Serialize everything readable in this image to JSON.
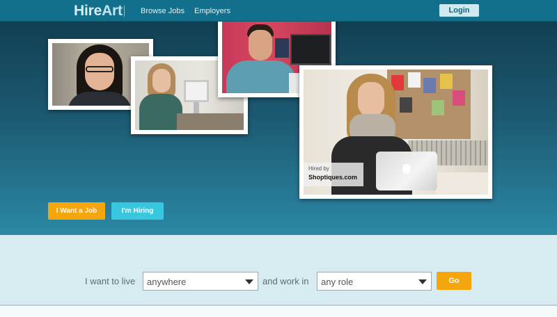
{
  "brand": {
    "name_hire": "Hire",
    "name_art": "Art"
  },
  "nav": {
    "browse_jobs": "Browse Jobs",
    "employers": "Employers",
    "login": "Login"
  },
  "hero": {
    "caption_line1": "Hired by",
    "caption_line2": "Shoptiques.com",
    "want_job_button": "I Want a Job",
    "hiring_button": "I'm Hiring"
  },
  "search": {
    "live_label": "I want to live",
    "live_value": "anywhere",
    "work_label": "and work in",
    "role_value": "any role",
    "go_button": "Go"
  },
  "colors": {
    "topbar": "#13708c",
    "accent_orange": "#f5a60d",
    "accent_cyan": "#39c6df",
    "band": "#d6ecf0"
  }
}
